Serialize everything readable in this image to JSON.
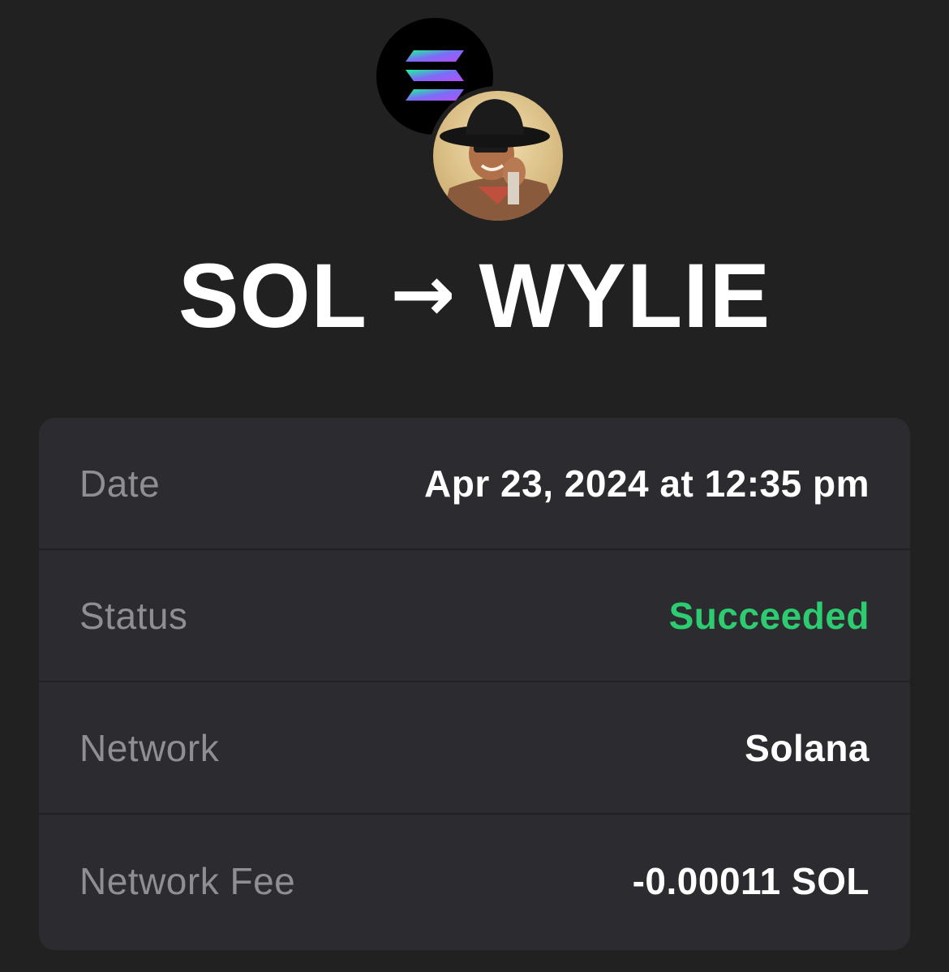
{
  "header": {
    "from_token": "SOL",
    "to_token": "WYLIE",
    "arrow": "→"
  },
  "icons": {
    "from_icon": "solana-logo-icon",
    "to_icon": "wylie-token-avatar"
  },
  "details": {
    "rows": [
      {
        "label": "Date",
        "value": "Apr 23, 2024 at 12:35 pm"
      },
      {
        "label": "Status",
        "value": "Succeeded"
      },
      {
        "label": "Network",
        "value": "Solana"
      },
      {
        "label": "Network Fee",
        "value": "-0.00011 SOL"
      }
    ]
  },
  "colors": {
    "background": "#212122",
    "card": "#2c2c30",
    "label": "#8e8e93",
    "success": "#2ecc71"
  }
}
